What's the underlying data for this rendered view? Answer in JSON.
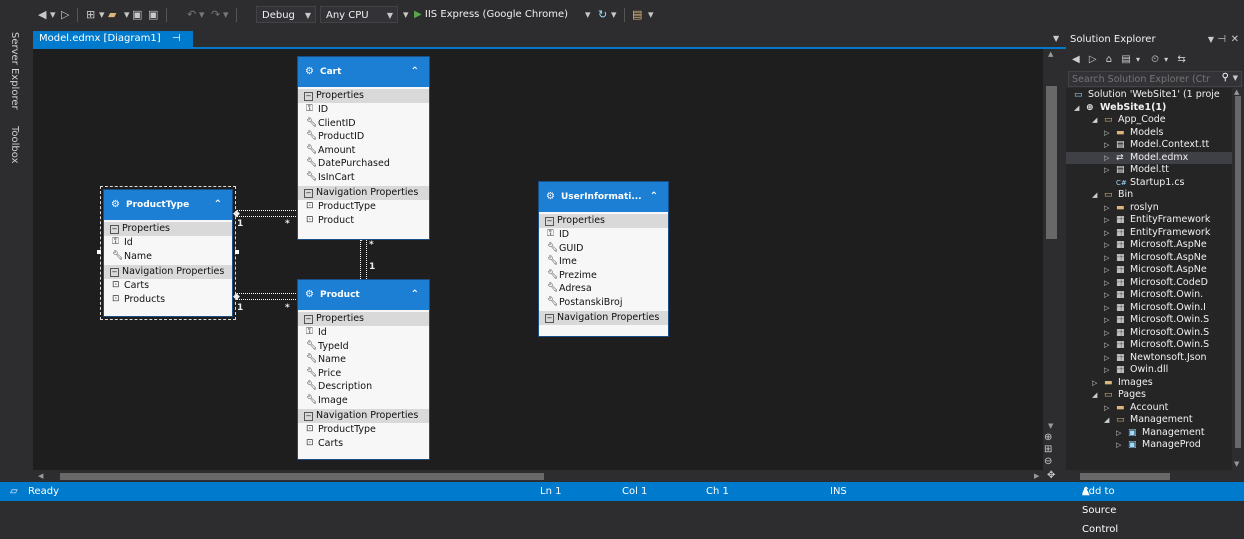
{
  "toolbar": {
    "config": "Debug",
    "platform": "Any CPU",
    "run_target": "IIS Express (Google Chrome)"
  },
  "rail": {
    "server_explorer": "Server Explorer",
    "toolbox": "Toolbox"
  },
  "document_tab": {
    "title": "Model.edmx [Diagram1]",
    "pin": "⊣",
    "close": "✕"
  },
  "entities": {
    "cart": {
      "title": "Cart",
      "properties_label": "Properties",
      "properties": [
        "ID",
        "ClientID",
        "ProductID",
        "Amount",
        "DatePurchased",
        "IsInCart"
      ],
      "nav_label": "Navigation Properties",
      "navigation": [
        "ProductType",
        "Product"
      ]
    },
    "product_type": {
      "title": "ProductType",
      "properties_label": "Properties",
      "properties": [
        "Id",
        "Name"
      ],
      "nav_label": "Navigation Properties",
      "navigation": [
        "Carts",
        "Products"
      ]
    },
    "product": {
      "title": "Product",
      "properties_label": "Properties",
      "properties": [
        "Id",
        "TypeId",
        "Name",
        "Price",
        "Description",
        "Image"
      ],
      "nav_label": "Navigation Properties",
      "navigation": [
        "ProductType",
        "Carts"
      ]
    },
    "user_info": {
      "title": "UserInformati...",
      "properties_label": "Properties",
      "properties": [
        "ID",
        "GUID",
        "Ime",
        "Prezime",
        "Adresa",
        "PostanskiBroj"
      ],
      "nav_label": "Navigation Properties"
    }
  },
  "multiplicity": {
    "one": "1",
    "many": "*"
  },
  "solution_explorer": {
    "title": "Solution Explorer",
    "search_placeholder": "Search Solution Explorer (Ctr",
    "tree": [
      {
        "label": "Solution 'WebSite1' (1 proje",
        "icon": "solution-icon"
      },
      {
        "label": "WebSite1(1)",
        "icon": "website-icon"
      },
      {
        "label": "App_Code",
        "icon": "folder-icon"
      },
      {
        "label": "Models",
        "icon": "folder-icon"
      },
      {
        "label": "Model.Context.tt",
        "icon": "file-icon"
      },
      {
        "label": "Model.edmx",
        "icon": "edmx-icon"
      },
      {
        "label": "Model.tt",
        "icon": "file-icon"
      },
      {
        "label": "Startup1.cs",
        "icon": "csharp-icon"
      },
      {
        "label": "Bin",
        "icon": "folder-icon"
      },
      {
        "label": "roslyn",
        "icon": "folder-icon"
      },
      {
        "label": "EntityFramework",
        "icon": "dll-icon"
      },
      {
        "label": "EntityFramework",
        "icon": "dll-icon"
      },
      {
        "label": "Microsoft.AspNe",
        "icon": "dll-icon"
      },
      {
        "label": "Microsoft.AspNe",
        "icon": "dll-icon"
      },
      {
        "label": "Microsoft.AspNe",
        "icon": "dll-icon"
      },
      {
        "label": "Microsoft.CodeD",
        "icon": "dll-icon"
      },
      {
        "label": "Microsoft.Owin.",
        "icon": "dll-icon"
      },
      {
        "label": "Microsoft.Owin.I",
        "icon": "dll-icon"
      },
      {
        "label": "Microsoft.Owin.S",
        "icon": "dll-icon"
      },
      {
        "label": "Microsoft.Owin.S",
        "icon": "dll-icon"
      },
      {
        "label": "Microsoft.Owin.S",
        "icon": "dll-icon"
      },
      {
        "label": "Newtonsoft.Json",
        "icon": "dll-icon"
      },
      {
        "label": "Owin.dll",
        "icon": "dll-icon"
      },
      {
        "label": "Images",
        "icon": "folder-icon"
      },
      {
        "label": "Pages",
        "icon": "folder-icon"
      },
      {
        "label": "Account",
        "icon": "folder-icon"
      },
      {
        "label": "Management",
        "icon": "folder-icon"
      },
      {
        "label": "Management",
        "icon": "page-icon"
      },
      {
        "label": "ManageProd",
        "icon": "page-icon"
      }
    ]
  },
  "status": {
    "ready": "Ready",
    "line": "Ln 1",
    "col": "Col 1",
    "ch": "Ch 1",
    "ins": "INS",
    "source_control": "Add to Source Control"
  },
  "colors": {
    "accent": "#007acc",
    "entity_header": "#1c7fd4",
    "run": "#57a64a"
  }
}
